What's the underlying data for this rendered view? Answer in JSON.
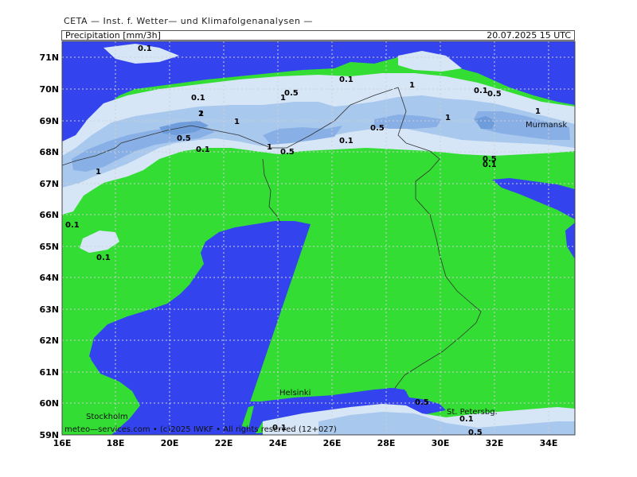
{
  "header": {
    "organization": "CETA — Inst. f. Wetter— und Klimafolgenanalysen —",
    "variable": "Precipitation [mm/3h]",
    "datetime": "20.07.2025 15 UTC"
  },
  "axes": {
    "lat_labels": [
      "71N",
      "70N",
      "69N",
      "68N",
      "67N",
      "66N",
      "65N",
      "64N",
      "63N",
      "62N",
      "61N",
      "60N",
      "59N"
    ],
    "lon_labels": [
      "16E",
      "18E",
      "20E",
      "22E",
      "24E",
      "26E",
      "28E",
      "30E",
      "32E",
      "34E"
    ]
  },
  "contour_labels": [
    "0.1",
    "0.1",
    "0.1",
    "0.1",
    "0.1",
    "0.1",
    "0.1",
    "0.1",
    "0.1",
    "0.1",
    "0.1",
    "0.5",
    "0.5",
    "0.5",
    "0.5",
    "0.5",
    "0.5",
    "0.5",
    "0.5",
    "1",
    "1",
    "1",
    "1",
    "1",
    "1",
    "1",
    "1",
    "2"
  ],
  "cities": {
    "murmansk": "Murmansk",
    "helsinki": "Helsinki",
    "stockholm": "Stockholm",
    "st_petersburg": "St. Petersbg."
  },
  "footer": "meteo—services.com • (c)2025 IWKF • All rights reserved (12+027)",
  "colors": {
    "sea": "#3344ee",
    "land": "#33dd33",
    "precip_01": "#d6e6f7",
    "precip_05": "#a9c8ee",
    "precip_1": "#88b0e6",
    "precip_2": "#6f9ddc",
    "border": "#333333"
  }
}
